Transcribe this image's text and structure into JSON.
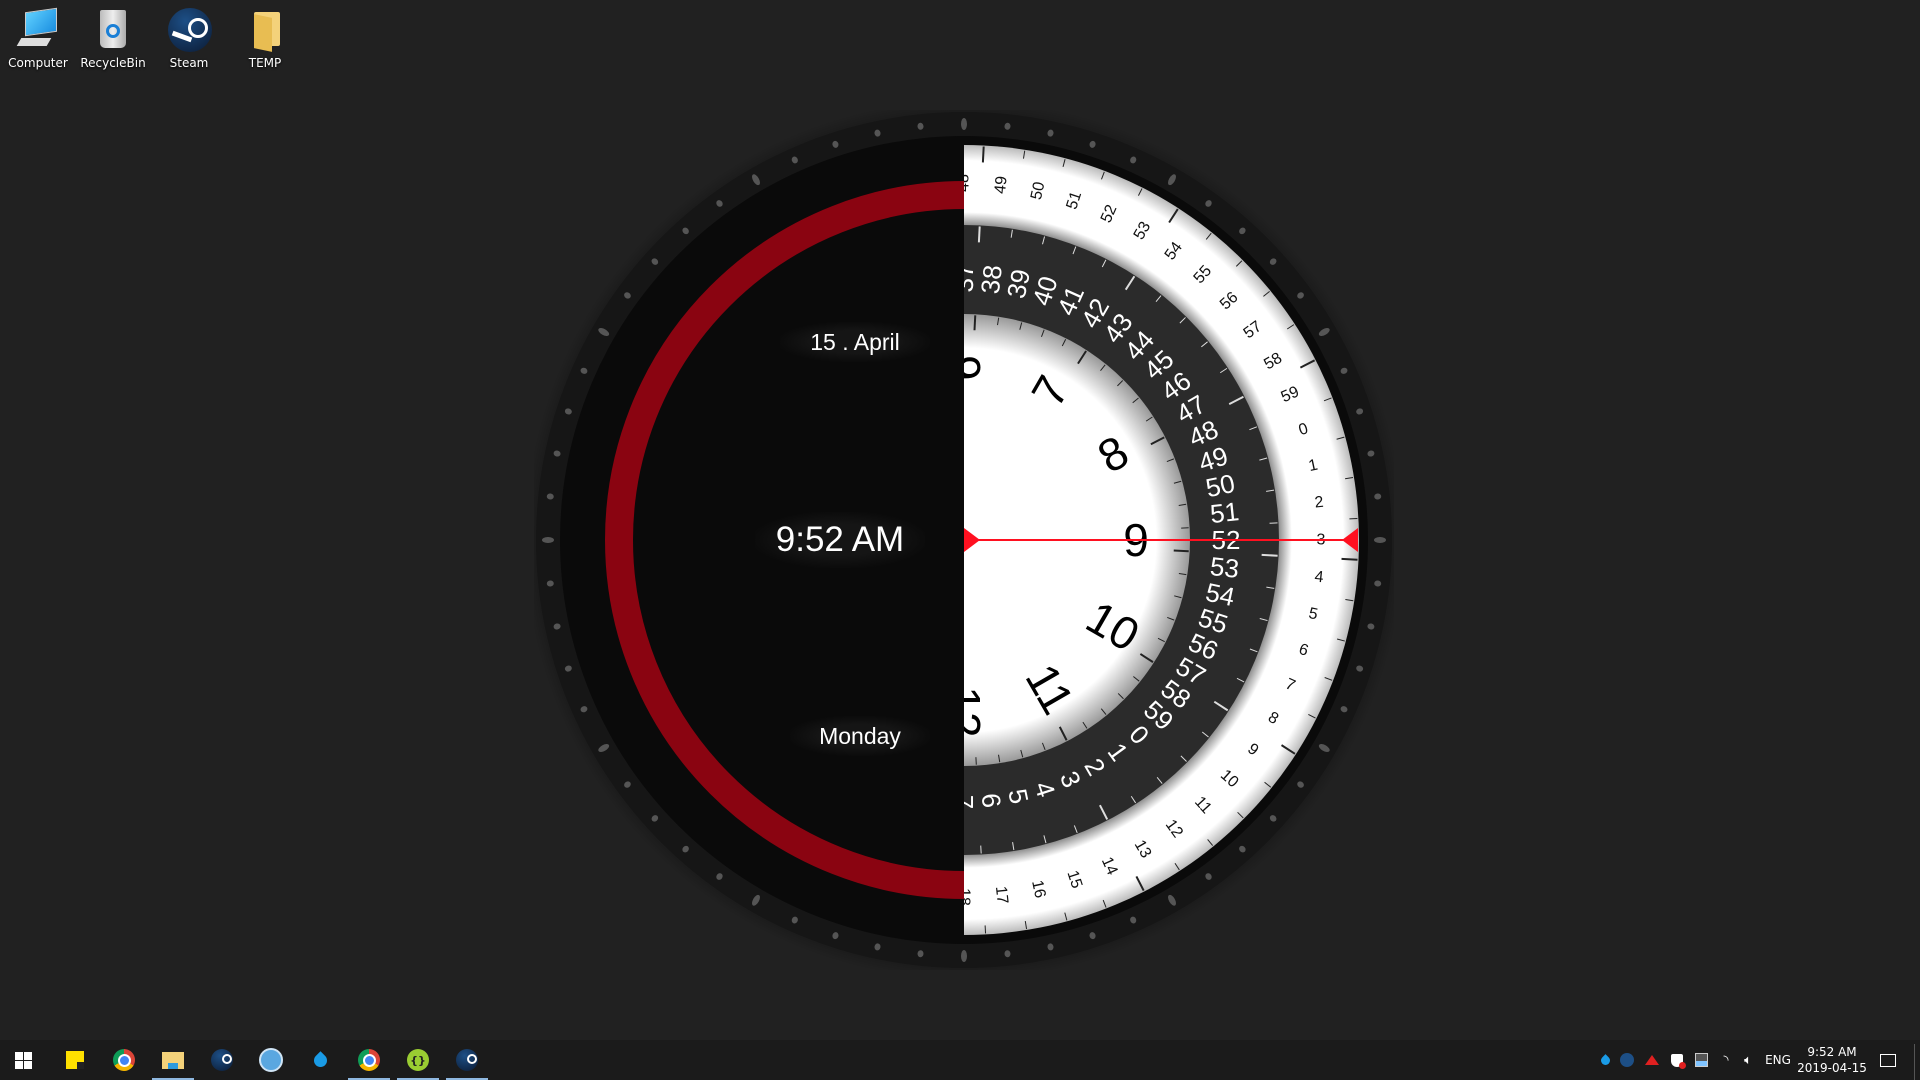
{
  "desktop": {
    "icons": [
      {
        "label": "Computer",
        "icon": "computer-icon"
      },
      {
        "label": "RecycleBin",
        "icon": "recycle-bin-icon"
      },
      {
        "label": "Steam",
        "icon": "steam-icon"
      },
      {
        "label": "TEMP",
        "icon": "folder-icon"
      }
    ]
  },
  "clock": {
    "date": "15 . April",
    "time": "9:52 AM",
    "day": "Monday",
    "hours_ring": {
      "current": 9,
      "count": 12
    },
    "minutes_ring": {
      "current": 52,
      "count": 60
    },
    "seconds_ring": {
      "current": 3,
      "count": 60
    },
    "colors": {
      "accent": "#8a0411",
      "pointer": "#ff1020",
      "face": "#ffffff",
      "dark": "#2b2b2b"
    }
  },
  "taskbar": {
    "apps": [
      {
        "name": "start",
        "icon": "windows-icon",
        "active": false
      },
      {
        "name": "sticky-notes",
        "icon": "sticky-notes-icon",
        "active": false
      },
      {
        "name": "chrome",
        "icon": "chrome-icon",
        "active": false
      },
      {
        "name": "file-explorer",
        "icon": "folder-icon",
        "active": true
      },
      {
        "name": "steam",
        "icon": "steam-icon",
        "active": false
      },
      {
        "name": "droplet-app",
        "icon": "droplet-circle-icon",
        "active": false
      },
      {
        "name": "water-app",
        "icon": "water-drop-icon",
        "active": false
      },
      {
        "name": "chrome-2",
        "icon": "chrome-icon",
        "active": true
      },
      {
        "name": "brackets-app",
        "icon": "brackets-icon",
        "active": true
      },
      {
        "name": "steam-2",
        "icon": "steam-icon",
        "active": true
      }
    ],
    "tray": {
      "language": "ENG",
      "time": "9:52 AM",
      "date": "2019-04-15"
    }
  }
}
